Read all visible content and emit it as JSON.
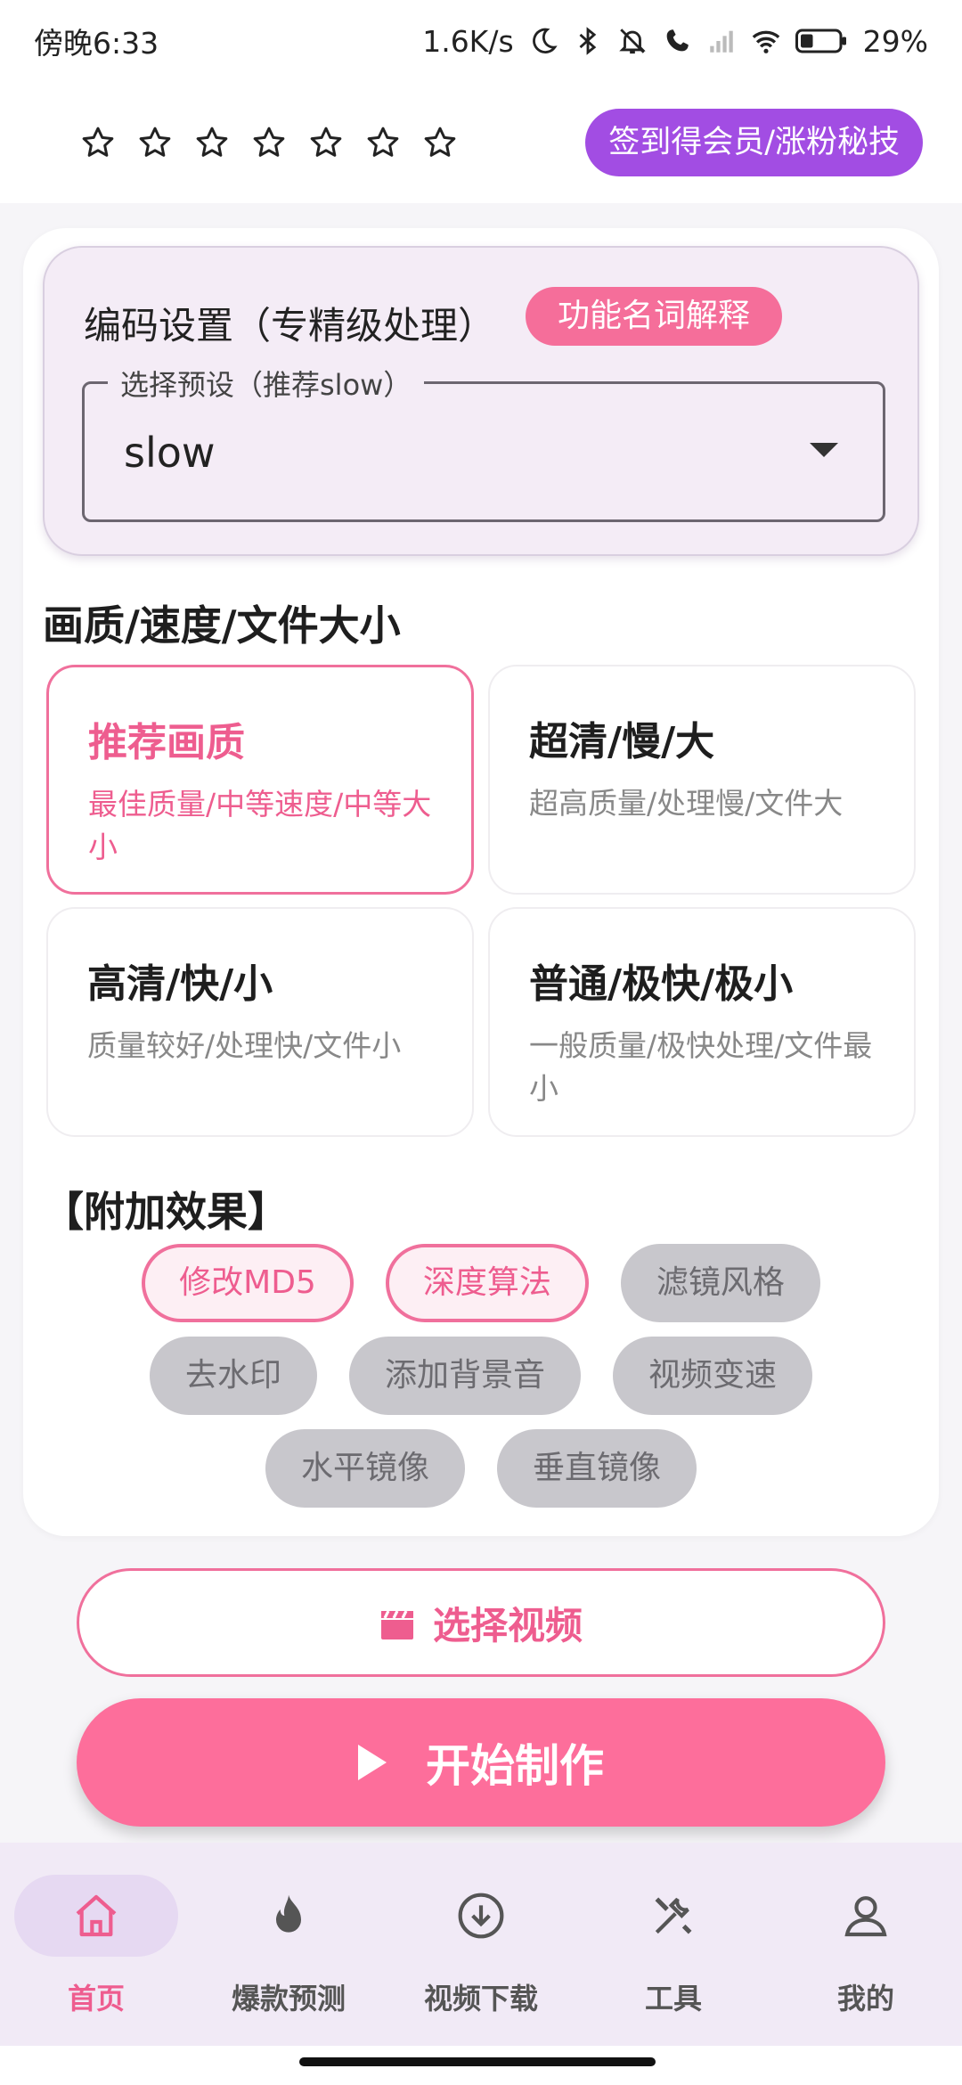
{
  "status_bar": {
    "time": "傍晚6:33",
    "net_speed": "1.6K/s",
    "battery": "29%",
    "icons": [
      "moon-icon",
      "bluetooth-icon",
      "bell-muted-icon",
      "call-icon",
      "signal-icon",
      "wifi-icon",
      "battery-icon"
    ]
  },
  "header": {
    "star_count": 7,
    "member_button": "签到得会员/涨粉秘技"
  },
  "encode": {
    "title": "编码设置（专精级处理）",
    "explain_button": "功能名词解释",
    "preset_label": "选择预设（推荐slow）",
    "preset_value": "slow"
  },
  "quality": {
    "section_title": "画质/速度/文件大小",
    "options": [
      {
        "title": "推荐画质",
        "subtitle": "最佳质量/中等速度/中等大小",
        "selected": true
      },
      {
        "title": "超清/慢/大",
        "subtitle": "超高质量/处理慢/文件大",
        "selected": false
      },
      {
        "title": "高清/快/小",
        "subtitle": "质量较好/处理快/文件小",
        "selected": false
      },
      {
        "title": "普通/极快/极小",
        "subtitle": "一般质量/极快处理/文件最小",
        "selected": false
      }
    ]
  },
  "extras": {
    "section_title": "【附加效果】",
    "chips": [
      {
        "label": "修改MD5",
        "active": true
      },
      {
        "label": "深度算法",
        "active": true
      },
      {
        "label": "滤镜风格",
        "active": false
      },
      {
        "label": "去水印",
        "active": false
      },
      {
        "label": "添加背景音",
        "active": false
      },
      {
        "label": "视频变速",
        "active": false
      },
      {
        "label": "水平镜像",
        "active": false
      },
      {
        "label": "垂直镜像",
        "active": false
      }
    ]
  },
  "actions": {
    "select_video": "选择视频",
    "start": "开始制作"
  },
  "nav": {
    "items": [
      {
        "label": "首页",
        "icon": "home-icon",
        "active": true
      },
      {
        "label": "爆款预测",
        "icon": "flame-icon",
        "active": false
      },
      {
        "label": "视频下载",
        "icon": "download-icon",
        "active": false
      },
      {
        "label": "工具",
        "icon": "tools-icon",
        "active": false
      },
      {
        "label": "我的",
        "icon": "user-icon",
        "active": false
      }
    ]
  },
  "colors": {
    "accent_pink": "#f0709c",
    "member_purple": "#a24de3",
    "start_button": "#fd6e9b"
  }
}
